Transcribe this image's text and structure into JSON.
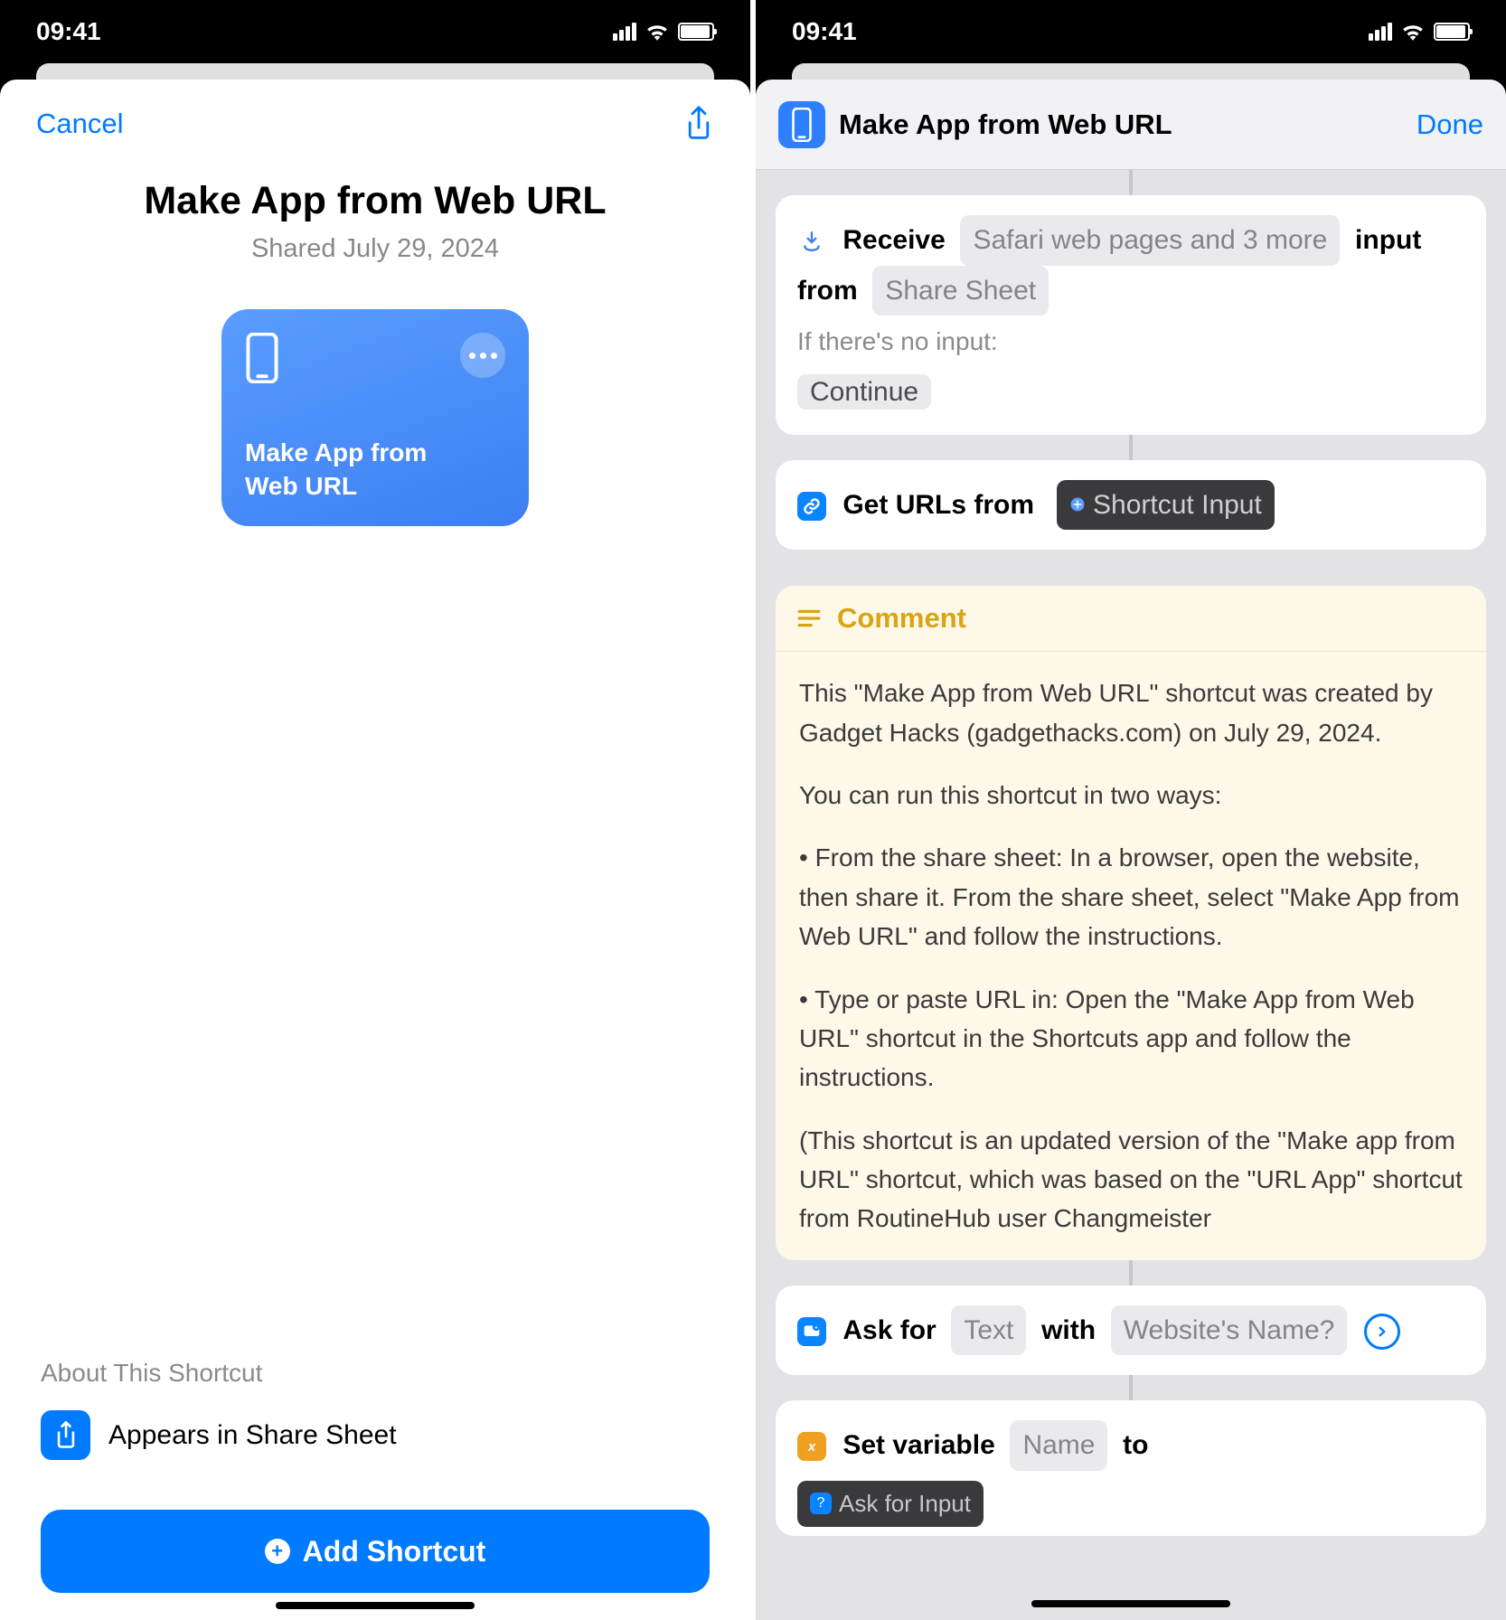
{
  "status": {
    "time": "09:41"
  },
  "left": {
    "cancel": "Cancel",
    "title": "Make App from Web URL",
    "shared": "Shared July 29, 2024",
    "tile_label_l1": "Make App from",
    "tile_label_l2": "Web URL",
    "about_header": "About This Shortcut",
    "appears_text": "Appears in Share Sheet",
    "add_btn": "Add Shortcut"
  },
  "right": {
    "header_title": "Make App from Web URL",
    "done": "Done",
    "receive": {
      "verb": "Receive",
      "types": "Safari web pages and 3 more",
      "input_from": "input from",
      "source": "Share Sheet",
      "no_input_label": "If there's no input:",
      "no_input_action": "Continue"
    },
    "geturls": {
      "label": "Get URLs from",
      "token": "Shortcut Input"
    },
    "comment": {
      "header": "Comment",
      "p1": "This \"Make App from Web URL\" shortcut was created by Gadget Hacks (gadgethacks.com) on July 29, 2024.",
      "p2": "You can run this shortcut in two ways:",
      "p3": "• From the share sheet: In a browser, open the website, then share it. From the share sheet, select \"Make App from Web URL\" and follow the instructions.",
      "p4": "• Type or paste URL in: Open the \"Make App from Web URL\" shortcut in the Shortcuts app and follow the instructions.",
      "p5": "(This shortcut is an updated version of the \"Make app from URL\" shortcut, which was based on the \"URL App\" shortcut from RoutineHub user Changmeister"
    },
    "ask": {
      "verb": "Ask for",
      "type": "Text",
      "with": "with",
      "prompt": "Website's Name?"
    },
    "setvar": {
      "verb": "Set variable",
      "name": "Name",
      "to": "to",
      "value": "Ask for Input"
    }
  }
}
